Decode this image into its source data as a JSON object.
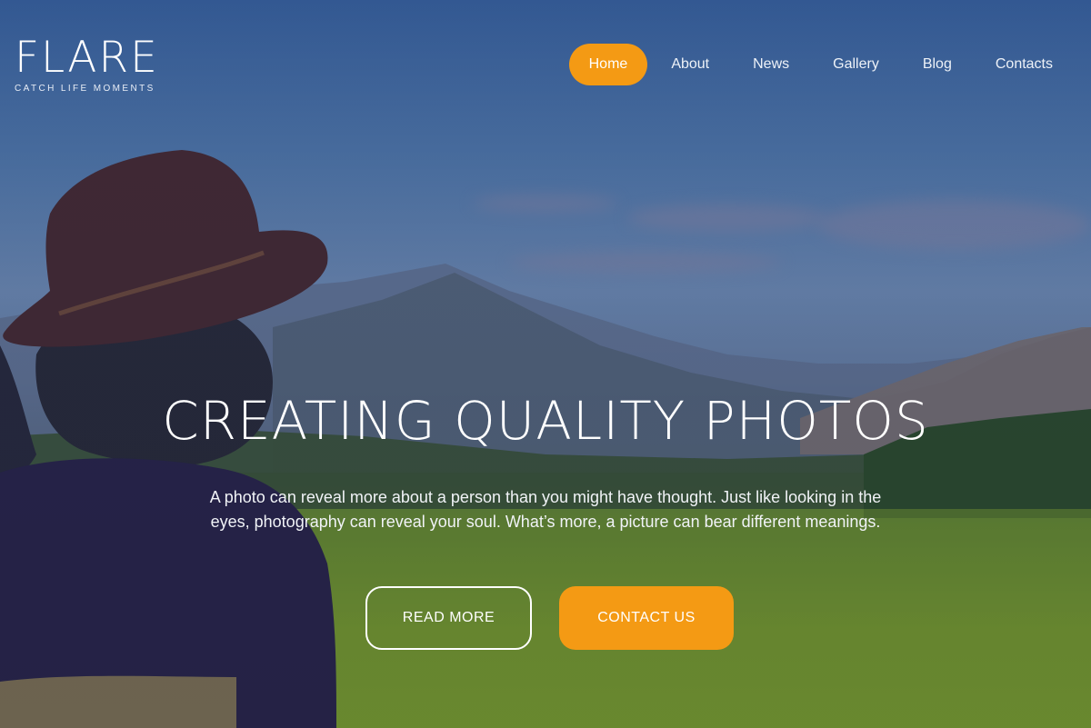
{
  "brand": {
    "name": "FLARE",
    "tagline": "CATCH LIFE MOMENTS"
  },
  "nav": {
    "items": [
      {
        "label": "Home",
        "active": true
      },
      {
        "label": "About"
      },
      {
        "label": "News"
      },
      {
        "label": "Gallery"
      },
      {
        "label": "Blog"
      },
      {
        "label": "Contacts"
      }
    ]
  },
  "hero": {
    "title": "CREATING QUALITY PHOTOS",
    "description": "A photo can reveal more about a person than you might have thought. Just like looking in the eyes, photography can reveal your soul. What’s more, a picture can bear different meanings.",
    "read_more_label": "READ MORE",
    "contact_label": "CONTACT US"
  },
  "colors": {
    "accent": "#f49a14",
    "text": "#ffffff"
  }
}
